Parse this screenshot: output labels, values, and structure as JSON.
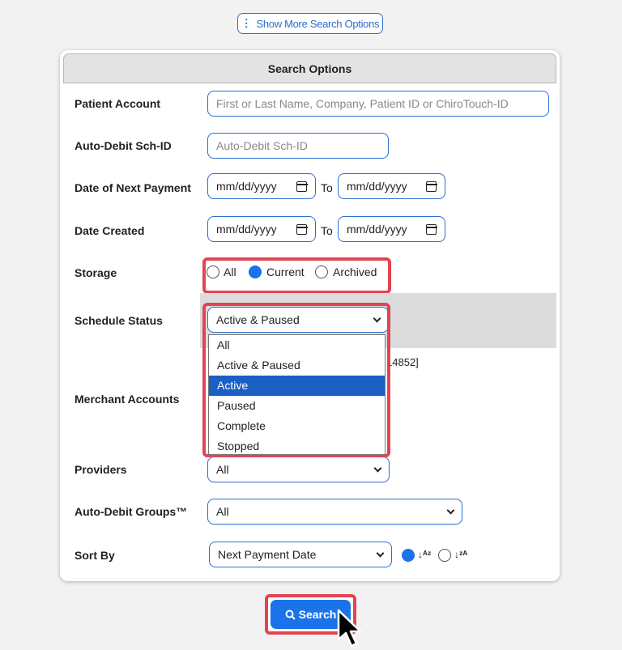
{
  "top_button": {
    "label": "Show More Search Options",
    "icon": "vertical-ellipsis-icon"
  },
  "panel": {
    "title": "Search Options"
  },
  "fields": {
    "patient_account": {
      "label": "Patient Account",
      "placeholder": "First or Last Name, Company, Patient ID or ChiroTouch-ID"
    },
    "auto_debit_id": {
      "label": "Auto-Debit Sch-ID",
      "placeholder": "Auto-Debit Sch-ID"
    },
    "next_payment": {
      "label": "Date of Next Payment",
      "from": "mm/dd/yyyy",
      "to_label": "To",
      "to": "mm/dd/yyyy"
    },
    "date_created": {
      "label": "Date Created",
      "from": "mm/dd/yyyy",
      "to_label": "To",
      "to": "mm/dd/yyyy"
    },
    "storage": {
      "label": "Storage",
      "options": [
        "All",
        "Current",
        "Archived"
      ],
      "selected": "Current"
    },
    "schedule_status": {
      "label": "Schedule Status",
      "value": "Active & Paused",
      "options": [
        "All",
        "Active & Paused",
        "Active",
        "Paused",
        "Complete",
        "Stopped"
      ],
      "highlighted": "Active"
    },
    "merchant_accounts": {
      "label": "Merchant Accounts",
      "partial_text": "14852]"
    },
    "providers": {
      "label": "Providers",
      "value": "All"
    },
    "groups": {
      "label": "Auto-Debit Groups™",
      "value": "All"
    },
    "sort_by": {
      "label": "Sort By",
      "value": "Next Payment Date",
      "asc_icon": "↓ᴬᶻ",
      "desc_icon": "↓ᶻᴬ",
      "selected": "ascending"
    }
  },
  "search_button": {
    "label": "Search",
    "icon": "search-icon"
  },
  "colors": {
    "accent": "#1a73e8",
    "highlight": "#e34453",
    "border": "#2a6fcf"
  }
}
